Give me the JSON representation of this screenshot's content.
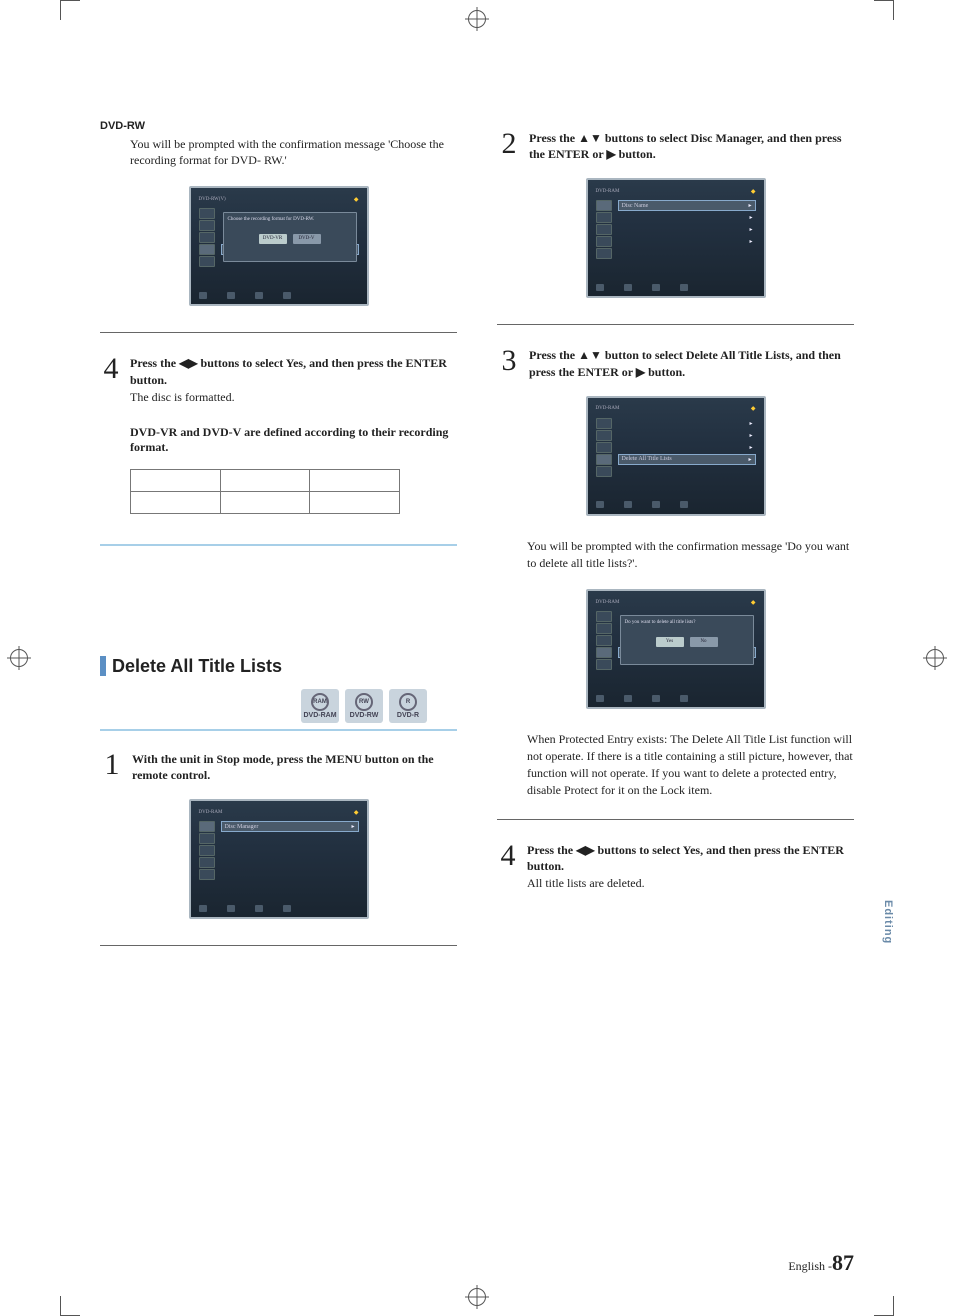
{
  "left": {
    "dvdrw_label": "DVD-RW",
    "dvdrw_body": "You will be prompted with the confirmation message 'Choose the recording format for DVD- RW.'",
    "step4": {
      "num": "4",
      "text": "Press the ◀▶ buttons to select Yes, and then press the ENTER button.",
      "sub": "The disc is formatted."
    },
    "note1": "DVD-VR and DVD-V are defined according to their recording format.",
    "section_title": "Delete All Title Lists",
    "badges": [
      "DVD-RAM",
      "DVD-RW",
      "DVD-R"
    ],
    "step1": {
      "num": "1",
      "text": "With the unit in Stop mode, press the MENU button on the remote control."
    }
  },
  "right": {
    "step2": {
      "num": "2",
      "text": "Press the ▲▼ buttons to select Disc Manager, and then press the ENTER or ▶ button."
    },
    "step3": {
      "num": "3",
      "text": "Press the ▲▼ button to select Delete All Title Lists, and then press the ENTER or ▶ button."
    },
    "confirm_msg": "You will be prompted with the confirmation message 'Do you want to delete all title lists?'.",
    "protected_note": "When Protected Entry exists: The Delete All Title List function will not operate. If there is a title containing a still picture, however, that function will not operate. If you want to delete a protected entry, disable Protect for it on the Lock item.",
    "step4": {
      "num": "4",
      "text": "Press the ◀▶ buttons to select Yes, and then press the ENTER button.",
      "sub": "All title lists are deleted."
    }
  },
  "sidebar": "Editing",
  "footer_lang": "English -",
  "footer_page": "87"
}
